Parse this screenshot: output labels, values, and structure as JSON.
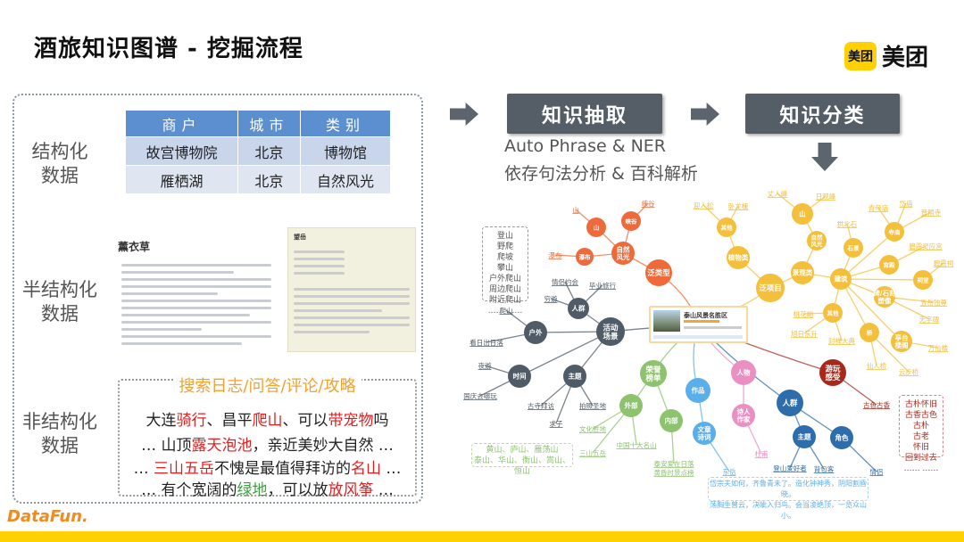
{
  "title": "酒旅知识图谱 - 挖掘流程",
  "brand": {
    "badge": "美团",
    "name": "美团",
    "footer": "DataFun."
  },
  "left": {
    "structured": "结构化\n数据",
    "semi": "半结构化\n数据",
    "unstructured": "非结构化\n数据",
    "table": {
      "headers": [
        "商户",
        "城市",
        "类别"
      ],
      "rows": [
        [
          "故宫博物院",
          "北京",
          "博物馆"
        ],
        [
          "雁栖湖",
          "北京",
          "自然风光"
        ]
      ]
    },
    "shot1_title": "薰衣草",
    "shot2_title": "望岳",
    "unstr_title": "搜索日志/问答/评论/攻略",
    "lines": [
      [
        [
          "大连",
          ""
        ],
        [
          "骑行",
          "r"
        ],
        [
          "、昌平",
          ""
        ],
        [
          "爬山",
          "r"
        ],
        [
          "、可以",
          ""
        ],
        [
          "带宠物",
          "r"
        ],
        [
          "吗",
          ""
        ]
      ],
      [
        [
          "… 山顶",
          ""
        ],
        [
          "露天泡池",
          "r"
        ],
        [
          "，亲近美妙大自然 …",
          ""
        ]
      ],
      [
        [
          "… ",
          ""
        ],
        [
          "三山五岳",
          "r"
        ],
        [
          "不愧是最值得拜访的",
          ""
        ],
        [
          "名山",
          "r"
        ],
        [
          " …",
          ""
        ]
      ],
      [
        [
          "… 有个宽阔的",
          ""
        ],
        [
          "绿地",
          "g"
        ],
        [
          "，可以放",
          ""
        ],
        [
          "放风筝",
          "r"
        ],
        [
          " …",
          ""
        ]
      ]
    ]
  },
  "pipeline": {
    "step1": "知识抽取",
    "step2": "知识分类",
    "sub1": "Auto Phrase & NER",
    "sub2": "依存句法分析 & 百科解析"
  },
  "colors": {
    "orange": "#ef6a3a",
    "yellow": "#f4bf3a",
    "dark": "#4f5b66",
    "green": "#8dc26f",
    "lblue": "#5aaeea",
    "pink": "#ea8fc2",
    "dblue": "#2e6dab",
    "red": "#a8291b"
  },
  "card": {
    "title": "泰山风景名胜区"
  },
  "boxes": {
    "climb": [
      "登山",
      "野爬",
      "爬坡",
      "攀山",
      "户外爬山",
      "周边爬山",
      "附近爬山",
      "…… ……"
    ],
    "mountains": [
      "黄山、庐山、雁荡山",
      "泰山、华山、衡山、嵩山、恒山"
    ],
    "poem": [
      "岱宗夫如何，齐鲁青未了。造化钟神秀，阴阳割昏晓。",
      "荡胸生曾云，决眦入归鸟。会当凌绝顶，一览众山小。"
    ],
    "feel": [
      "古朴怀旧",
      "古香古色",
      "古朴",
      "古老",
      "怀旧",
      "回到过去",
      "…… ……"
    ]
  },
  "nodes": [
    {
      "id": "o0",
      "label": "泛类型",
      "group": "orange"
    },
    {
      "id": "o1",
      "label": "自然\n风光",
      "group": "orange"
    },
    {
      "id": "o2",
      "label": "山",
      "group": "orange"
    },
    {
      "id": "o3",
      "label": "峡谷",
      "group": "orange"
    },
    {
      "id": "o4",
      "label": "瀑布",
      "group": "orange"
    },
    {
      "id": "ol1",
      "label": "山",
      "group": "orange"
    },
    {
      "id": "ol2",
      "label": "峡谷",
      "group": "orange"
    },
    {
      "id": "ol3",
      "label": "瀑布",
      "group": "orange"
    },
    {
      "id": "d0",
      "label": "活动\n场景",
      "group": "dark"
    },
    {
      "id": "d1",
      "label": "人群",
      "group": "dark"
    },
    {
      "id": "d2",
      "label": "户外",
      "group": "dark"
    },
    {
      "id": "d3",
      "label": "时间",
      "group": "dark"
    },
    {
      "id": "d4",
      "label": "主题",
      "group": "dark"
    },
    {
      "id": "dl1",
      "label": "情侣约会",
      "group": "dark"
    },
    {
      "id": "dl2",
      "label": "毕业旅行",
      "group": "dark"
    },
    {
      "id": "dl3",
      "label": "穷游",
      "group": "dark"
    },
    {
      "id": "dl4",
      "label": "爬山",
      "group": "dark"
    },
    {
      "id": "dl5",
      "label": "看日出日落",
      "group": "dark"
    },
    {
      "id": "dl6",
      "label": "夜游",
      "group": "dark"
    },
    {
      "id": "dl7",
      "label": "国庆去哪玩",
      "group": "dark"
    },
    {
      "id": "dl8",
      "label": "古寺拜访",
      "group": "dark"
    },
    {
      "id": "dl9",
      "label": "求子",
      "group": "dark"
    },
    {
      "id": "dl10",
      "label": "拍照圣地",
      "group": "dark"
    },
    {
      "id": "g0",
      "label": "荣誉\n榜单",
      "group": "green"
    },
    {
      "id": "g1",
      "label": "外部",
      "group": "green"
    },
    {
      "id": "g2",
      "label": "内部",
      "group": "green"
    },
    {
      "id": "gl1",
      "label": "文化胜地",
      "group": "green"
    },
    {
      "id": "gl2",
      "label": "中国十大名山",
      "group": "green"
    },
    {
      "id": "gl3",
      "label": "三山五岳",
      "group": "green"
    },
    {
      "id": "gl4",
      "label": "泰安爱在日落\n黄昏时景点榜",
      "group": "green"
    },
    {
      "id": "b0",
      "label": "作品",
      "group": "lblue"
    },
    {
      "id": "b1",
      "label": "文章\n诗词",
      "group": "lblue"
    },
    {
      "id": "bl1",
      "label": "东岳",
      "group": "lblue"
    },
    {
      "id": "p0",
      "label": "人物",
      "group": "pink"
    },
    {
      "id": "p1",
      "label": "诗人\n作家",
      "group": "pink"
    },
    {
      "id": "pl1",
      "label": "杜甫",
      "group": "pink"
    },
    {
      "id": "n0",
      "label": "人群",
      "group": "dblue"
    },
    {
      "id": "n1",
      "label": "主题",
      "group": "dblue"
    },
    {
      "id": "n2",
      "label": "角色",
      "group": "dblue"
    },
    {
      "id": "nl1",
      "label": "登山爱好者",
      "group": "dblue"
    },
    {
      "id": "nl2",
      "label": "背包客",
      "group": "dblue"
    },
    {
      "id": "nl3",
      "label": "情侣",
      "group": "dblue"
    },
    {
      "id": "r0",
      "label": "游玩\n感受",
      "group": "red"
    },
    {
      "id": "rl1",
      "label": "古色古香",
      "group": "red"
    },
    {
      "id": "y0",
      "label": "泛项目",
      "group": "yellow"
    },
    {
      "id": "y1",
      "label": "植物类",
      "group": "yellow"
    },
    {
      "id": "y2",
      "label": "其他",
      "group": "yellow"
    },
    {
      "id": "y3",
      "label": "景观类",
      "group": "yellow"
    },
    {
      "id": "y4",
      "label": "自然\n风光",
      "group": "yellow"
    },
    {
      "id": "y5",
      "label": "山",
      "group": "yellow"
    },
    {
      "id": "y6",
      "label": "建筑",
      "group": "yellow"
    },
    {
      "id": "y7",
      "label": "石景",
      "group": "yellow"
    },
    {
      "id": "y8",
      "label": "寺庙",
      "group": "yellow"
    },
    {
      "id": "y9",
      "label": "宫殿",
      "group": "yellow"
    },
    {
      "id": "y10",
      "label": "祠堂",
      "group": "yellow"
    },
    {
      "id": "y11",
      "label": "碑/石刻\n塑像",
      "group": "yellow"
    },
    {
      "id": "y12",
      "label": "其他",
      "group": "yellow"
    },
    {
      "id": "y13",
      "label": "桥",
      "group": "yellow"
    },
    {
      "id": "y14",
      "label": "亭台\n楼阁",
      "group": "yellow"
    },
    {
      "id": "yl1",
      "label": "迎人松",
      "group": "yellow"
    },
    {
      "id": "yl2",
      "label": "卧龙槐",
      "group": "yellow"
    },
    {
      "id": "yl3",
      "label": "丈人峰",
      "group": "yellow"
    },
    {
      "id": "yl4",
      "label": "日观峰",
      "group": "yellow"
    },
    {
      "id": "yl5",
      "label": "拱北石",
      "group": "yellow"
    },
    {
      "id": "yl6",
      "label": "青帝庙",
      "group": "yellow"
    },
    {
      "id": "yl7",
      "label": "岱庙",
      "group": "yellow"
    },
    {
      "id": "yl8",
      "label": "普照寺",
      "group": "yellow"
    },
    {
      "id": "yl9",
      "label": "碧霞灵应宫",
      "group": "yellow"
    },
    {
      "id": "yl10",
      "label": "碧霞祠",
      "group": "yellow"
    },
    {
      "id": "yl11",
      "label": "五岳独尊",
      "group": "yellow"
    },
    {
      "id": "yl12",
      "label": "无字碑",
      "group": "yellow"
    },
    {
      "id": "yl13",
      "label": "桃花峪",
      "group": "yellow"
    },
    {
      "id": "yl14",
      "label": "旭日东升",
      "group": "yellow"
    },
    {
      "id": "yl15",
      "label": "封禅大典",
      "group": "yellow"
    },
    {
      "id": "yl16",
      "label": "仙人桥",
      "group": "yellow"
    },
    {
      "id": "yl17",
      "label": "云步桥",
      "group": "yellow"
    },
    {
      "id": "yl18",
      "label": "万仙楼",
      "group": "yellow"
    }
  ]
}
